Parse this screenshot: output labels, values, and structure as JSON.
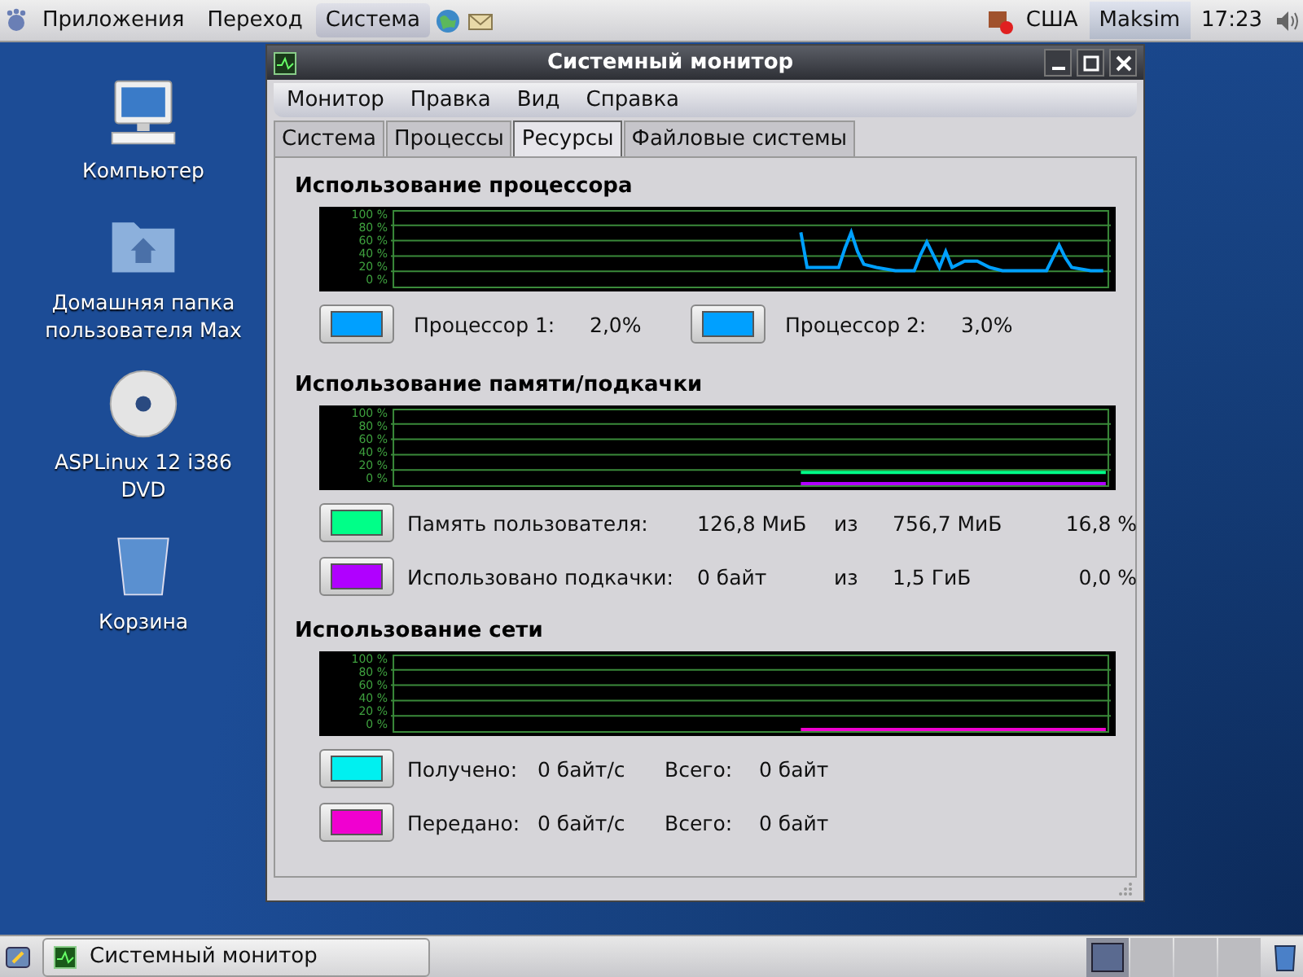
{
  "top_panel": {
    "menus": [
      "Приложения",
      "Переход",
      "Система"
    ],
    "keyboard_layout": "США",
    "user": "Maksim",
    "clock": "17:23"
  },
  "desktop_icons": [
    {
      "kind": "computer",
      "label": "Компьютер"
    },
    {
      "kind": "home",
      "label": "Домашняя папка пользователя Max"
    },
    {
      "kind": "dvd",
      "label": "ASPLinux 12 i386 DVD"
    },
    {
      "kind": "trash",
      "label": "Корзина"
    }
  ],
  "window": {
    "title": "Системный монитор",
    "menu": [
      "Монитор",
      "Правка",
      "Вид",
      "Справка"
    ],
    "tabs": [
      {
        "label": "Система",
        "selected": false
      },
      {
        "label": "Процессы",
        "selected": false
      },
      {
        "label": "Ресурсы",
        "selected": true
      },
      {
        "label": "Файловые системы",
        "selected": false
      }
    ]
  },
  "cpu": {
    "title": "Использование процессора",
    "axis_labels": [
      "100 %",
      "80 %",
      "60 %",
      "40 %",
      "20 %",
      "0 %"
    ],
    "legend": [
      {
        "color": "#00a0ff",
        "name": "Процессор 1:",
        "value": "2,0%"
      },
      {
        "color": "#00a0ff",
        "name": "Процессор 2:",
        "value": "3,0%"
      }
    ]
  },
  "memory": {
    "title": "Использование памяти/подкачки",
    "axis_labels": [
      "100 %",
      "80 %",
      "60 %",
      "40 %",
      "20 %",
      "0 %"
    ],
    "rows": [
      {
        "color": "#00ff88",
        "name": "Память пользователя:",
        "used": "126,8 МиБ",
        "of": "из",
        "total": "756,7 МиБ",
        "percent": "16,8 %"
      },
      {
        "color": "#b000ff",
        "name": "Использовано подкачки:",
        "used": "0 байт",
        "of": "из",
        "total": "1,5 ГиБ",
        "percent": "0,0 %"
      }
    ]
  },
  "network": {
    "title": "Использование сети",
    "axis_labels": [
      "100 %",
      "80 %",
      "60 %",
      "40 %",
      "20 %",
      "0 %"
    ],
    "rows": [
      {
        "color": "#00f0f0",
        "name": "Получено:",
        "rate": "0 байт/с",
        "total_label": "Всего:",
        "total": "0 байт"
      },
      {
        "color": "#f000d0",
        "name": "Передано:",
        "rate": "0 байт/с",
        "total_label": "Всего:",
        "total": "0 байт"
      }
    ]
  },
  "taskbar": {
    "tasks": [
      {
        "label": "Системный монитор",
        "selected": false
      }
    ],
    "workspaces": [
      {
        "selected": true
      },
      {
        "selected": false
      },
      {
        "selected": false
      },
      {
        "selected": false
      }
    ]
  }
}
